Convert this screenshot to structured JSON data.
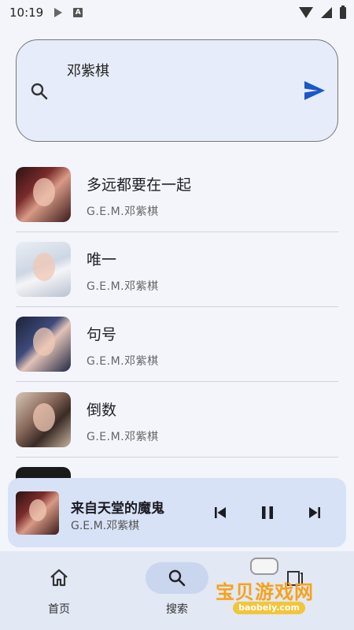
{
  "status_bar": {
    "time": "10:19",
    "a_badge": "A"
  },
  "search": {
    "query": "邓紫棋"
  },
  "results": [
    {
      "title": "多远都要在一起",
      "artist": "G.E.M.邓紫棋"
    },
    {
      "title": "唯一",
      "artist": "G.E.M.邓紫棋"
    },
    {
      "title": "句号",
      "artist": "G.E.M.邓紫棋"
    },
    {
      "title": "倒数",
      "artist": "G.E.M.邓紫棋"
    }
  ],
  "player": {
    "title": "来自天堂的魔鬼",
    "artist": "G.E.M.邓紫棋"
  },
  "nav": {
    "home_label": "首页",
    "search_label": "搜索"
  },
  "watermark": {
    "text": "宝贝游戏网",
    "url": "baobeiy.com"
  },
  "colors": {
    "accent": "#1a57c9",
    "search_bg": "#e6ecf9",
    "player_bg": "#d7e2f6",
    "nav_bg": "#e2e8f4"
  }
}
